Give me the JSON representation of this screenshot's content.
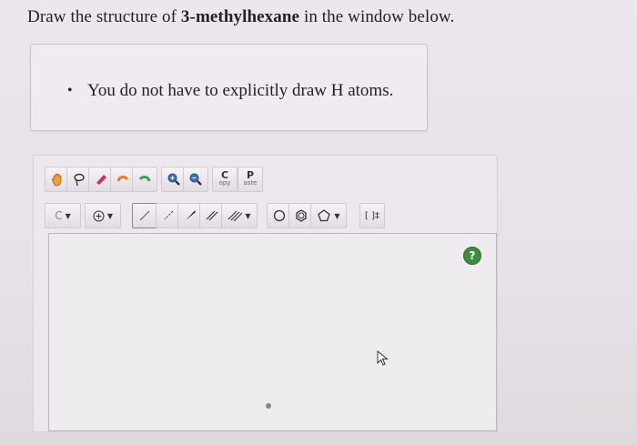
{
  "prompt": {
    "prefix": "Draw the structure of ",
    "compound": "3-methylhexane",
    "suffix": " in the window below."
  },
  "notes": [
    {
      "text": "You do not have to explicitly draw H atoms."
    }
  ],
  "toolbar": {
    "copy": {
      "big": "C",
      "small": "opy"
    },
    "paste": {
      "big": "P",
      "small": "aste"
    },
    "atom_select": "C",
    "bracket_tool": "[ ]‡"
  },
  "help": {
    "label": "?"
  }
}
